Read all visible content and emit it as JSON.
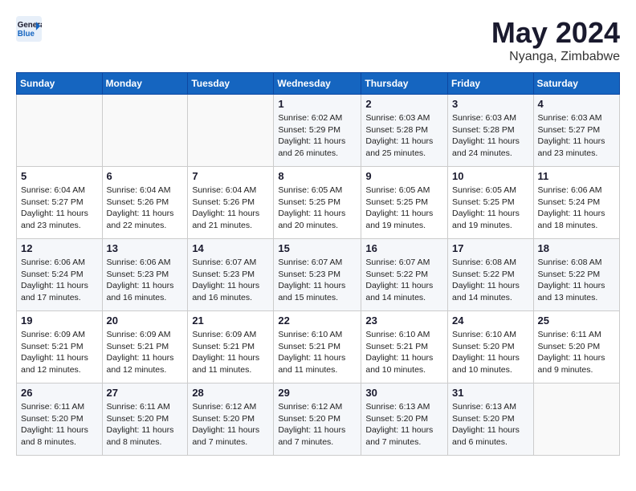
{
  "logo": {
    "line1": "General",
    "line2": "Blue"
  },
  "title": "May 2024",
  "location": "Nyanga, Zimbabwe",
  "weekdays": [
    "Sunday",
    "Monday",
    "Tuesday",
    "Wednesday",
    "Thursday",
    "Friday",
    "Saturday"
  ],
  "weeks": [
    [
      {
        "day": "",
        "sunrise": "",
        "sunset": "",
        "daylight": ""
      },
      {
        "day": "",
        "sunrise": "",
        "sunset": "",
        "daylight": ""
      },
      {
        "day": "",
        "sunrise": "",
        "sunset": "",
        "daylight": ""
      },
      {
        "day": "1",
        "sunrise": "Sunrise: 6:02 AM",
        "sunset": "Sunset: 5:29 PM",
        "daylight": "Daylight: 11 hours and 26 minutes."
      },
      {
        "day": "2",
        "sunrise": "Sunrise: 6:03 AM",
        "sunset": "Sunset: 5:28 PM",
        "daylight": "Daylight: 11 hours and 25 minutes."
      },
      {
        "day": "3",
        "sunrise": "Sunrise: 6:03 AM",
        "sunset": "Sunset: 5:28 PM",
        "daylight": "Daylight: 11 hours and 24 minutes."
      },
      {
        "day": "4",
        "sunrise": "Sunrise: 6:03 AM",
        "sunset": "Sunset: 5:27 PM",
        "daylight": "Daylight: 11 hours and 23 minutes."
      }
    ],
    [
      {
        "day": "5",
        "sunrise": "Sunrise: 6:04 AM",
        "sunset": "Sunset: 5:27 PM",
        "daylight": "Daylight: 11 hours and 23 minutes."
      },
      {
        "day": "6",
        "sunrise": "Sunrise: 6:04 AM",
        "sunset": "Sunset: 5:26 PM",
        "daylight": "Daylight: 11 hours and 22 minutes."
      },
      {
        "day": "7",
        "sunrise": "Sunrise: 6:04 AM",
        "sunset": "Sunset: 5:26 PM",
        "daylight": "Daylight: 11 hours and 21 minutes."
      },
      {
        "day": "8",
        "sunrise": "Sunrise: 6:05 AM",
        "sunset": "Sunset: 5:25 PM",
        "daylight": "Daylight: 11 hours and 20 minutes."
      },
      {
        "day": "9",
        "sunrise": "Sunrise: 6:05 AM",
        "sunset": "Sunset: 5:25 PM",
        "daylight": "Daylight: 11 hours and 19 minutes."
      },
      {
        "day": "10",
        "sunrise": "Sunrise: 6:05 AM",
        "sunset": "Sunset: 5:25 PM",
        "daylight": "Daylight: 11 hours and 19 minutes."
      },
      {
        "day": "11",
        "sunrise": "Sunrise: 6:06 AM",
        "sunset": "Sunset: 5:24 PM",
        "daylight": "Daylight: 11 hours and 18 minutes."
      }
    ],
    [
      {
        "day": "12",
        "sunrise": "Sunrise: 6:06 AM",
        "sunset": "Sunset: 5:24 PM",
        "daylight": "Daylight: 11 hours and 17 minutes."
      },
      {
        "day": "13",
        "sunrise": "Sunrise: 6:06 AM",
        "sunset": "Sunset: 5:23 PM",
        "daylight": "Daylight: 11 hours and 16 minutes."
      },
      {
        "day": "14",
        "sunrise": "Sunrise: 6:07 AM",
        "sunset": "Sunset: 5:23 PM",
        "daylight": "Daylight: 11 hours and 16 minutes."
      },
      {
        "day": "15",
        "sunrise": "Sunrise: 6:07 AM",
        "sunset": "Sunset: 5:23 PM",
        "daylight": "Daylight: 11 hours and 15 minutes."
      },
      {
        "day": "16",
        "sunrise": "Sunrise: 6:07 AM",
        "sunset": "Sunset: 5:22 PM",
        "daylight": "Daylight: 11 hours and 14 minutes."
      },
      {
        "day": "17",
        "sunrise": "Sunrise: 6:08 AM",
        "sunset": "Sunset: 5:22 PM",
        "daylight": "Daylight: 11 hours and 14 minutes."
      },
      {
        "day": "18",
        "sunrise": "Sunrise: 6:08 AM",
        "sunset": "Sunset: 5:22 PM",
        "daylight": "Daylight: 11 hours and 13 minutes."
      }
    ],
    [
      {
        "day": "19",
        "sunrise": "Sunrise: 6:09 AM",
        "sunset": "Sunset: 5:21 PM",
        "daylight": "Daylight: 11 hours and 12 minutes."
      },
      {
        "day": "20",
        "sunrise": "Sunrise: 6:09 AM",
        "sunset": "Sunset: 5:21 PM",
        "daylight": "Daylight: 11 hours and 12 minutes."
      },
      {
        "day": "21",
        "sunrise": "Sunrise: 6:09 AM",
        "sunset": "Sunset: 5:21 PM",
        "daylight": "Daylight: 11 hours and 11 minutes."
      },
      {
        "day": "22",
        "sunrise": "Sunrise: 6:10 AM",
        "sunset": "Sunset: 5:21 PM",
        "daylight": "Daylight: 11 hours and 11 minutes."
      },
      {
        "day": "23",
        "sunrise": "Sunrise: 6:10 AM",
        "sunset": "Sunset: 5:21 PM",
        "daylight": "Daylight: 11 hours and 10 minutes."
      },
      {
        "day": "24",
        "sunrise": "Sunrise: 6:10 AM",
        "sunset": "Sunset: 5:20 PM",
        "daylight": "Daylight: 11 hours and 10 minutes."
      },
      {
        "day": "25",
        "sunrise": "Sunrise: 6:11 AM",
        "sunset": "Sunset: 5:20 PM",
        "daylight": "Daylight: 11 hours and 9 minutes."
      }
    ],
    [
      {
        "day": "26",
        "sunrise": "Sunrise: 6:11 AM",
        "sunset": "Sunset: 5:20 PM",
        "daylight": "Daylight: 11 hours and 8 minutes."
      },
      {
        "day": "27",
        "sunrise": "Sunrise: 6:11 AM",
        "sunset": "Sunset: 5:20 PM",
        "daylight": "Daylight: 11 hours and 8 minutes."
      },
      {
        "day": "28",
        "sunrise": "Sunrise: 6:12 AM",
        "sunset": "Sunset: 5:20 PM",
        "daylight": "Daylight: 11 hours and 7 minutes."
      },
      {
        "day": "29",
        "sunrise": "Sunrise: 6:12 AM",
        "sunset": "Sunset: 5:20 PM",
        "daylight": "Daylight: 11 hours and 7 minutes."
      },
      {
        "day": "30",
        "sunrise": "Sunrise: 6:13 AM",
        "sunset": "Sunset: 5:20 PM",
        "daylight": "Daylight: 11 hours and 7 minutes."
      },
      {
        "day": "31",
        "sunrise": "Sunrise: 6:13 AM",
        "sunset": "Sunset: 5:20 PM",
        "daylight": "Daylight: 11 hours and 6 minutes."
      },
      {
        "day": "",
        "sunrise": "",
        "sunset": "",
        "daylight": ""
      }
    ]
  ]
}
